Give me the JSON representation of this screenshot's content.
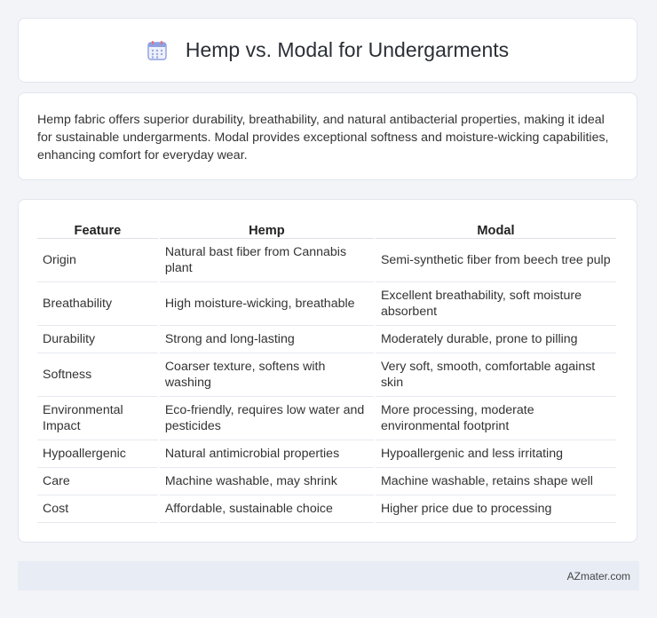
{
  "header": {
    "title": "Hemp vs. Modal for Undergarments",
    "icon": "calendar-icon",
    "icon_colors": {
      "frame": "#7b8fd6",
      "top": "#e86a7a",
      "dots": "#9aa8e0"
    }
  },
  "intro": {
    "text": "Hemp fabric offers superior durability, breathability, and natural antibacterial properties, making it ideal for sustainable undergarments. Modal provides exceptional softness and moisture-wicking capabilities, enhancing comfort for everyday wear."
  },
  "table": {
    "headers": [
      "Feature",
      "Hemp",
      "Modal"
    ],
    "rows": [
      [
        "Origin",
        "Natural bast fiber from Cannabis plant",
        "Semi-synthetic fiber from beech tree pulp"
      ],
      [
        "Breathability",
        "High moisture-wicking, breathable",
        "Excellent breathability, soft moisture absorbent"
      ],
      [
        "Durability",
        "Strong and long-lasting",
        "Moderately durable, prone to pilling"
      ],
      [
        "Softness",
        "Coarser texture, softens with washing",
        "Very soft, smooth, comfortable against skin"
      ],
      [
        "Environmental Impact",
        "Eco-friendly, requires low water and pesticides",
        "More processing, moderate environmental footprint"
      ],
      [
        "Hypoallergenic",
        "Natural antimicrobial properties",
        "Hypoallergenic and less irritating"
      ],
      [
        "Care",
        "Machine washable, may shrink",
        "Machine washable, retains shape well"
      ],
      [
        "Cost",
        "Affordable, sustainable choice",
        "Higher price due to processing"
      ]
    ]
  },
  "footer": {
    "brand": "AZmater.com"
  }
}
